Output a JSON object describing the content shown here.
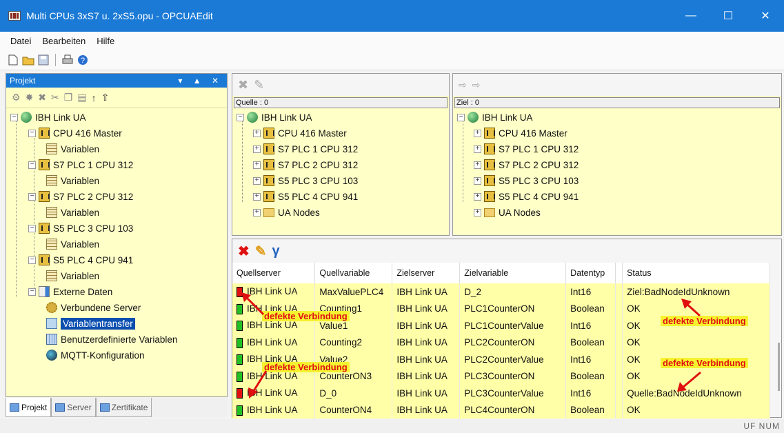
{
  "window": {
    "title": "Multi CPUs 3xS7 u. 2xS5.opu - OPCUAEdit"
  },
  "menu": [
    "Datei",
    "Bearbeiten",
    "Hilfe"
  ],
  "project_pane": {
    "header": "Projekt",
    "tree": {
      "root": "IBH Link UA",
      "cpus": [
        {
          "label": "CPU 416 Master",
          "child": "Variablen"
        },
        {
          "label": "S7 PLC 1 CPU 312",
          "child": "Variablen"
        },
        {
          "label": "S7 PLC 2 CPU 312",
          "child": "Variablen"
        },
        {
          "label": "S5 PLC 3 CPU 103",
          "child": "Variablen"
        },
        {
          "label": "S5 PLC 4 CPU 941",
          "child": "Variablen"
        }
      ],
      "external": "Externe Daten",
      "external_children": [
        "Verbundene Server",
        "Variablentransfer",
        "Benutzerdefinierte Variablen",
        "MQTT-Konfiguration"
      ]
    },
    "tabs": [
      "Projekt",
      "Server",
      "Zertifikate"
    ]
  },
  "source_pane": {
    "label": "Quelle : 0",
    "root": "IBH Link UA",
    "items": [
      "CPU 416 Master",
      "S7 PLC 1 CPU 312",
      "S7 PLC 2 CPU 312",
      "S5 PLC 3 CPU 103",
      "S5 PLC 4 CPU 941",
      "UA Nodes"
    ]
  },
  "target_pane": {
    "label": "Ziel : 0",
    "root": "IBH Link UA",
    "items": [
      "CPU 416 Master",
      "S7 PLC 1 CPU 312",
      "S7 PLC 2 CPU 312",
      "S5 PLC 3 CPU 103",
      "S5 PLC 4 CPU 941",
      "UA Nodes"
    ]
  },
  "transfer_table": {
    "columns": [
      "Quellserver",
      "Quellvariable",
      "Zielserver",
      "Zielvariable",
      "Datentyp",
      "",
      "Status"
    ],
    "rows": [
      {
        "conn": "bad",
        "src": "IBH Link UA",
        "srcvar": "MaxValuePLC4",
        "dst": "IBH Link UA",
        "dstvar": "D_2",
        "type": "Int16",
        "status": "Ziel:BadNodeIdUnknown"
      },
      {
        "conn": "ok",
        "src": "IBH Link UA",
        "srcvar": "Counting1",
        "dst": "IBH Link UA",
        "dstvar": "PLC1CounterON",
        "type": "Boolean",
        "status": "OK"
      },
      {
        "conn": "ok",
        "src": "IBH Link UA",
        "srcvar": "Value1",
        "dst": "IBH Link UA",
        "dstvar": "PLC1CounterValue",
        "type": "Int16",
        "status": "OK"
      },
      {
        "conn": "ok",
        "src": "IBH Link UA",
        "srcvar": "Counting2",
        "dst": "IBH Link UA",
        "dstvar": "PLC2CounterON",
        "type": "Boolean",
        "status": "OK"
      },
      {
        "conn": "ok",
        "src": "IBH Link UA",
        "srcvar": "Value2",
        "dst": "IBH Link UA",
        "dstvar": "PLC2CounterValue",
        "type": "Int16",
        "status": "OK"
      },
      {
        "conn": "ok",
        "src": "IBH Link UA",
        "srcvar": "CounterON3",
        "dst": "IBH Link UA",
        "dstvar": "PLC3CounterON",
        "type": "Boolean",
        "status": "OK"
      },
      {
        "conn": "bad",
        "src": "IBH Link UA",
        "srcvar": "D_0",
        "dst": "IBH Link UA",
        "dstvar": "PLC3CounterValue",
        "type": "Int16",
        "status": "Quelle:BadNodeIdUnknown"
      },
      {
        "conn": "ok",
        "src": "IBH Link UA",
        "srcvar": "CounterON4",
        "dst": "IBH Link UA",
        "dstvar": "PLC4CounterON",
        "type": "Boolean",
        "status": "OK"
      }
    ]
  },
  "annotations": [
    "defekte Verbindung",
    "defekte Verbindung",
    "defekte Verbindung",
    "defekte Verbindung"
  ],
  "statusbar": {
    "indicators": "UF NUM"
  },
  "colors": {
    "titlebar": "#1a7ad6",
    "tree_bg": "#ffffc8",
    "row_bg": "#ffffa8",
    "annotation_bg": "#f6f230",
    "annotation_text": "#e01010",
    "selection": "#0a4fb0"
  }
}
